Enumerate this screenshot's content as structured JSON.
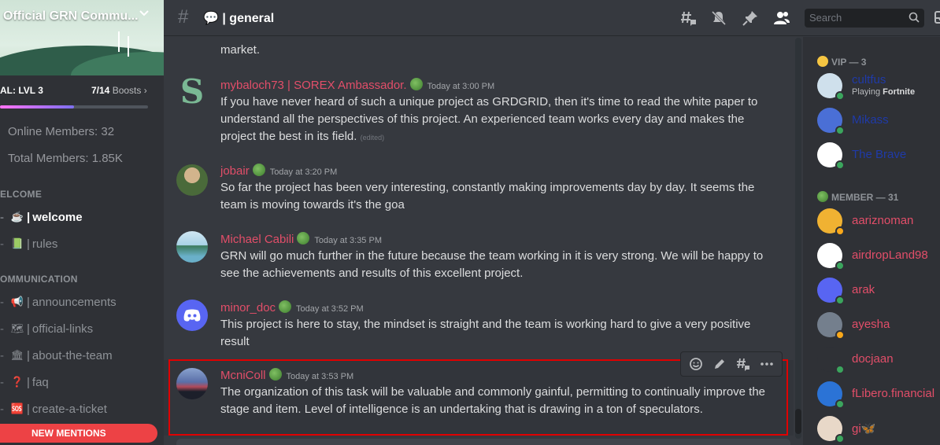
{
  "server": {
    "name": "Official GRN Commu...",
    "boost_goal": "AL: LVL 3",
    "boost_count": "7/14",
    "boost_suffix": "Boosts",
    "boost_progress": 0.5
  },
  "stats": {
    "online": "Online Members: 32",
    "total": "Total Members: 1.85K"
  },
  "categories": {
    "welcome": "ELCOME",
    "communication": "OMMUNICATION"
  },
  "channels": [
    {
      "emoji": "☕",
      "name": "welcome",
      "active": true
    },
    {
      "emoji": "📗",
      "name": "rules",
      "active": false
    },
    {
      "emoji": "📢",
      "name": "announcements",
      "active": false
    },
    {
      "emoji": "🗺",
      "name": "official-links",
      "active": false
    },
    {
      "emoji": "🏛",
      "name": "about-the-team",
      "active": false
    },
    {
      "emoji": "❓",
      "name": "faq",
      "active": false
    },
    {
      "emoji": "🆘",
      "name": "create-a-ticket",
      "active": false
    }
  ],
  "new_mentions": "NEW MENTIONS",
  "header": {
    "channel_emoji": "💬",
    "channel_name": "general",
    "search_placeholder": "Search",
    "icons": [
      "threads-icon",
      "mute-bell-icon",
      "pin-icon",
      "members-icon",
      "search-icon",
      "inbox-icon"
    ]
  },
  "messages": [
    {
      "author": "",
      "timestamp": "",
      "text": "market."
    },
    {
      "author": "mybaloch73 | SOREX Ambassador.",
      "timestamp": "Today at 3:00 PM",
      "text": "If you have never heard of such a unique project as GRDGRID, then it's time to read the white paper to understand all the perspectives of this project. An experienced team works every day and makes the project the best in its field.",
      "edited": "(edited)"
    },
    {
      "author": "jobair",
      "timestamp": "Today at 3:20 PM",
      "text": "So far the project has been very interesting, constantly making improvements day by day. It seems the team is moving towards it's the goa"
    },
    {
      "author": "Michael Cabili",
      "timestamp": "Today at 3:35 PM",
      "text": "GRN will go much further in the future because the team working in it is very strong. We will be happy to see the achievements and results of this excellent project."
    },
    {
      "author": "minor_doc",
      "timestamp": "Today at 3:52 PM",
      "text": "This project is here to stay, the mindset is straight and the team is working hard to give a very positive result"
    },
    {
      "author": "McniColl",
      "timestamp": "Today at 3:53 PM",
      "text": "The organization of this task will be valuable and commonly gainful, permitting to continually improve the stage and item. Level of intelligence is an undertaking that is drawing in a ton of speculators."
    }
  ],
  "member_list": {
    "vip_header": "VIP — 3",
    "vip": [
      {
        "name": "cultfus",
        "activity_prefix": "Playing",
        "activity": "Fortnite",
        "color": "#1f3aa8",
        "status": "#3ba55d"
      },
      {
        "name": "Mikass",
        "color": "#1f3aa8",
        "status": "#3ba55d"
      },
      {
        "name": "The Brave",
        "color": "#1f3aa8",
        "status": "#3ba55d"
      }
    ],
    "member_header": "MEMBER — 31",
    "members": [
      {
        "name": "aariznoman",
        "color": "#e24e69",
        "status": "#faa81a"
      },
      {
        "name": "airdropLand98",
        "color": "#e24e69",
        "status": "#3ba55d"
      },
      {
        "name": "arak",
        "color": "#e24e69",
        "status": "#3ba55d"
      },
      {
        "name": "ayesha",
        "color": "#e24e69",
        "status": "#faa81a"
      },
      {
        "name": "docjaan",
        "color": "#e24e69",
        "status": "#3ba55d"
      },
      {
        "name": "fLibero.financial",
        "color": "#e24e69",
        "status": "#3ba55d"
      },
      {
        "name": "gi🦋",
        "color": "#e24e69",
        "status": "#3ba55d"
      }
    ]
  }
}
